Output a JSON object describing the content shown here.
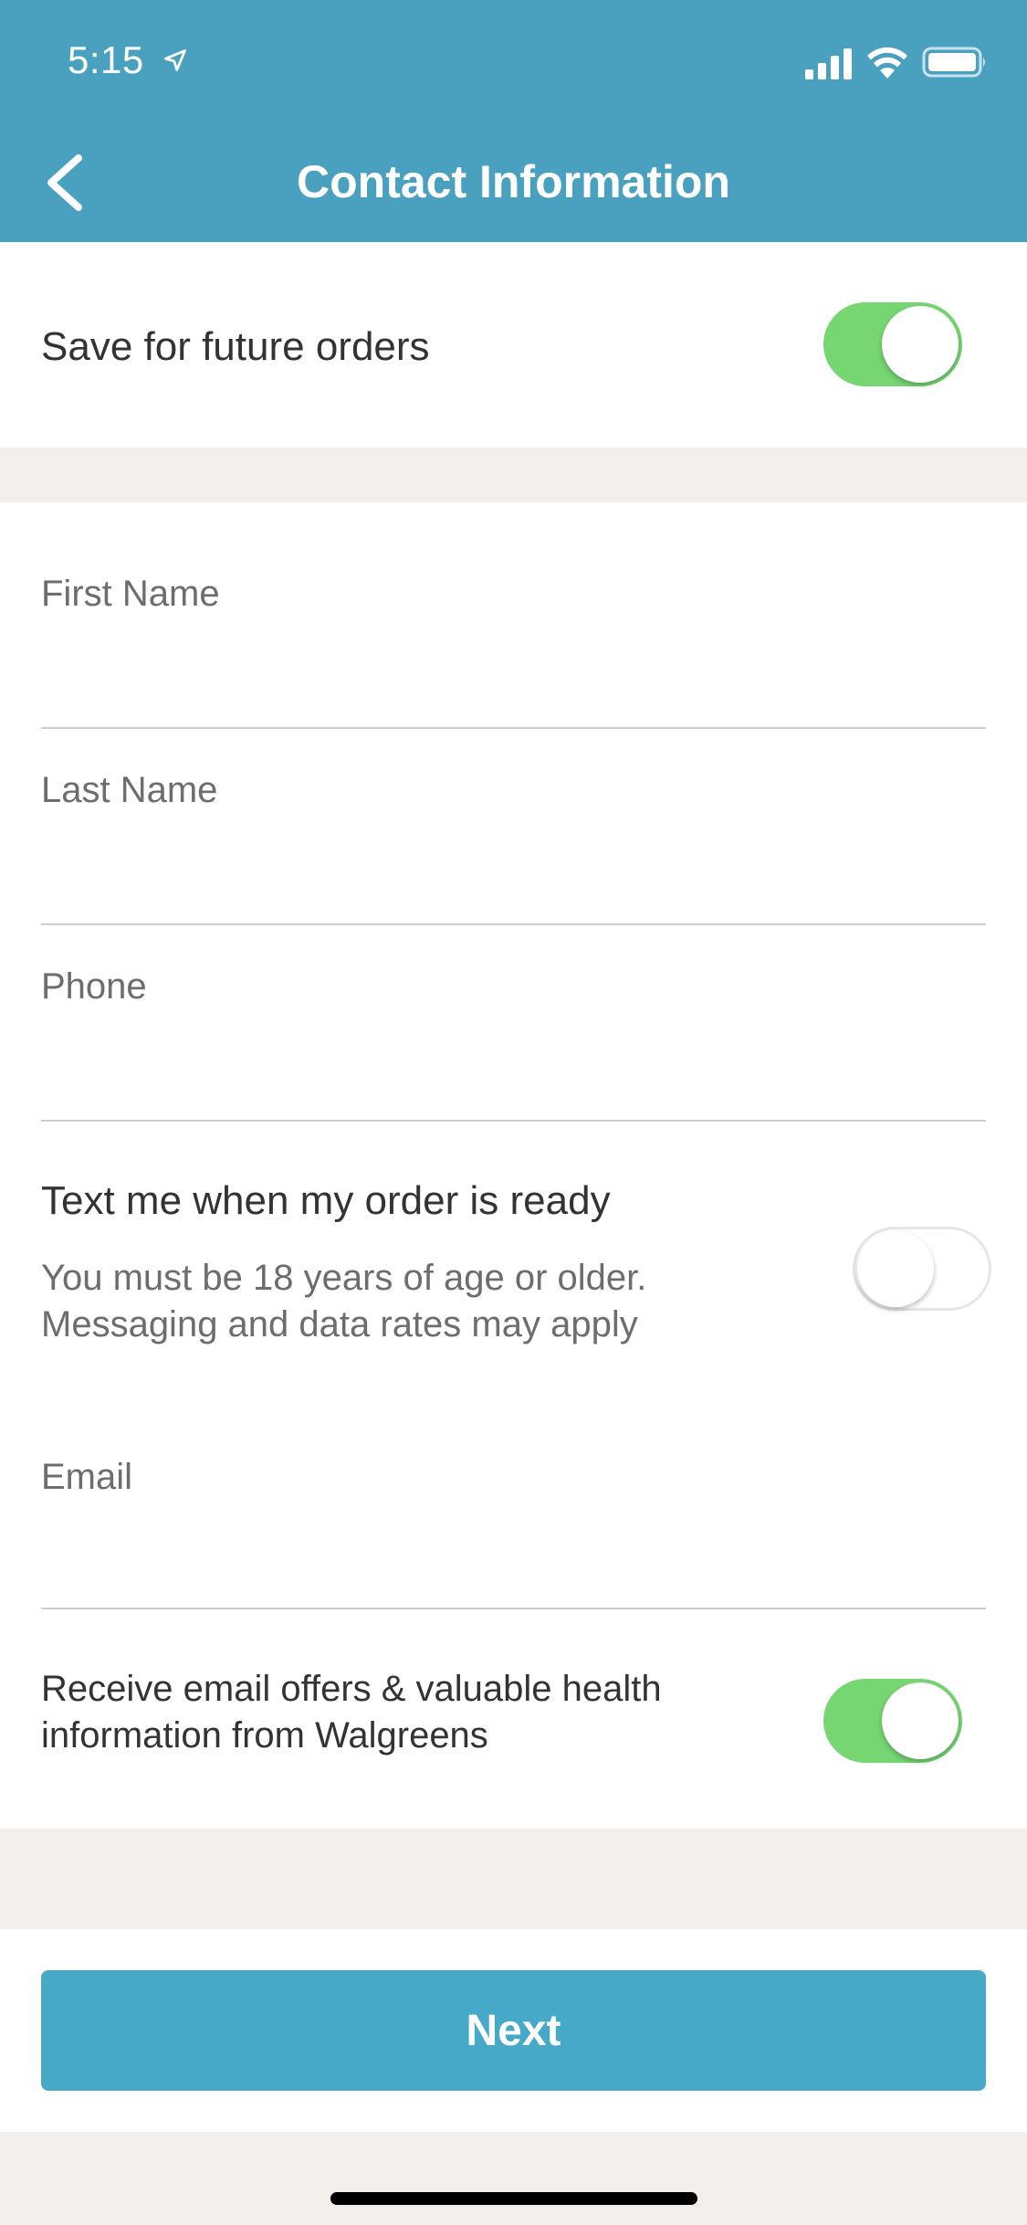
{
  "status_bar": {
    "time": "5:15",
    "icons": [
      "location-arrow-icon",
      "cellular-signal-icon",
      "wifi-icon",
      "battery-icon"
    ]
  },
  "header": {
    "title": "Contact Information",
    "back_icon": "chevron-left-icon",
    "background_color": "#49a0bf"
  },
  "save_section": {
    "label": "Save for future orders",
    "toggle_on": true
  },
  "form": {
    "first_name": {
      "label": "First Name",
      "value": ""
    },
    "last_name": {
      "label": "Last Name",
      "value": ""
    },
    "phone": {
      "label": "Phone",
      "value": ""
    },
    "text_me": {
      "label": "Text me when my order is ready",
      "note_line1": "You must be 18 years of age or older.",
      "note_line2": "Messaging and data rates may apply",
      "toggle_on": false
    },
    "email": {
      "label": "Email",
      "value": ""
    },
    "email_offers": {
      "line1": "Receive email offers & valuable health",
      "line2": "information from Walgreens",
      "toggle_on": true
    }
  },
  "footer": {
    "next_label": "Next",
    "button_color": "#47a9c8"
  },
  "colors": {
    "toggle_on": "#76d672",
    "background": "#f3efec"
  }
}
